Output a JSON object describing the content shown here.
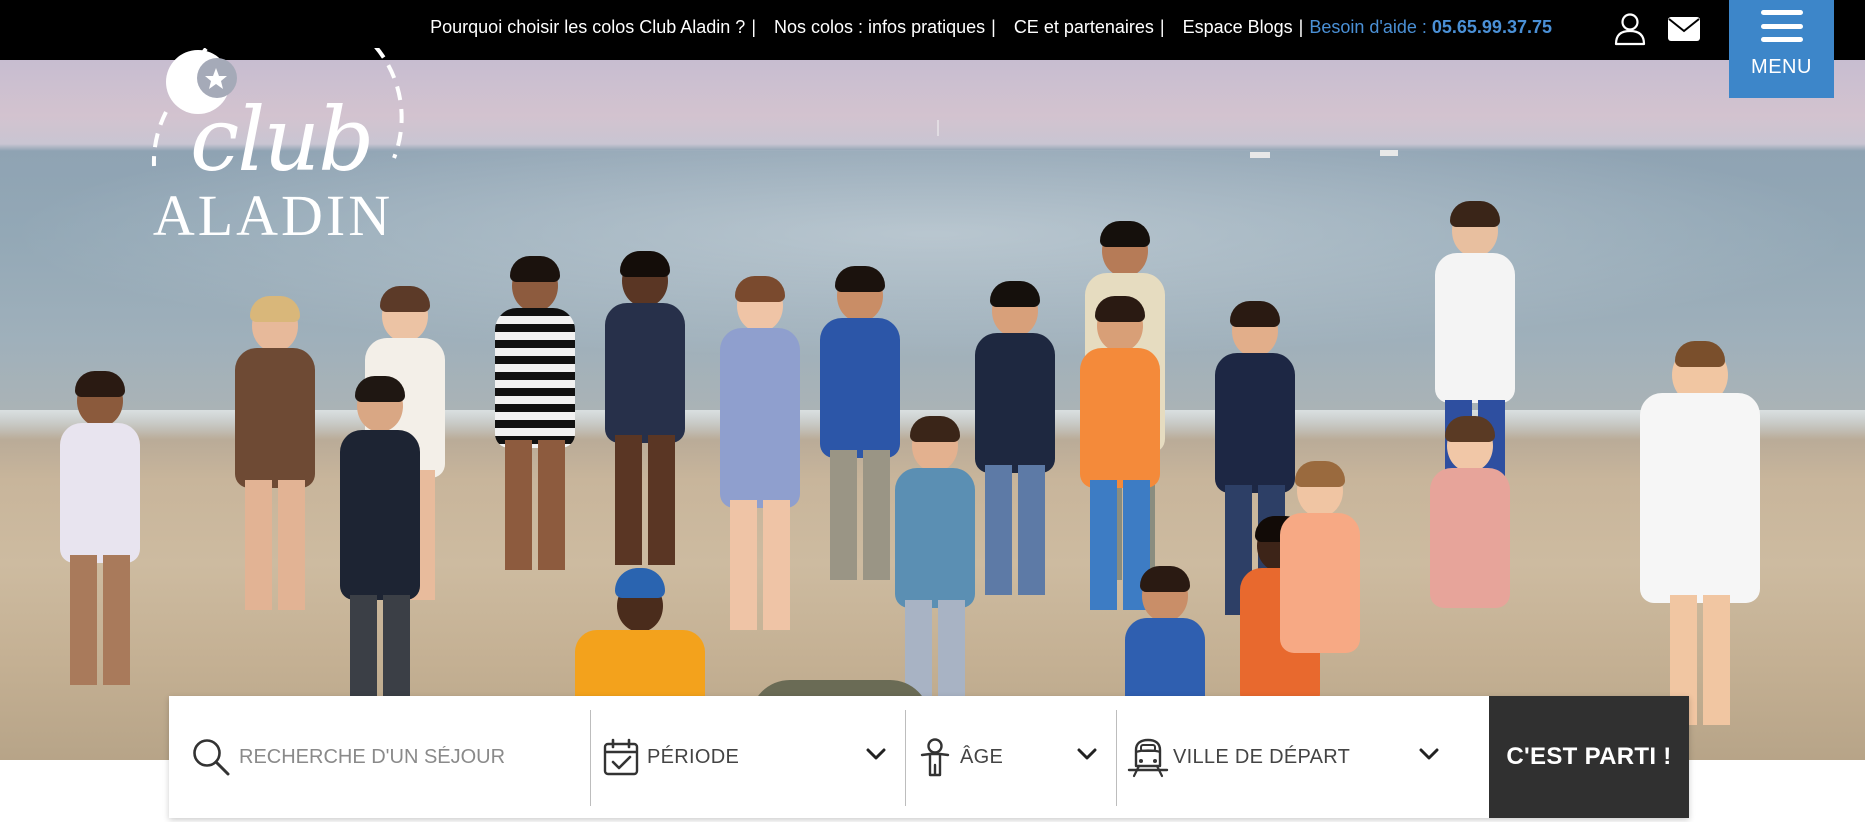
{
  "topnav": {
    "links": [
      "Pourquoi choisir les colos Club Aladin ?",
      "Nos colos : infos pratiques",
      "CE et partenaires",
      "Espace Blogs"
    ],
    "separator": "|",
    "help_label": "Besoin d'aide : ",
    "help_phone": "05.65.99.37.75",
    "account_icon": "user-icon",
    "contact_icon": "envelope-icon",
    "menu_label": "MENU",
    "menu_icon": "hamburger-icon"
  },
  "logo": {
    "script": "club",
    "name": "ALADIN"
  },
  "search": {
    "keyword_placeholder": "RECHERCHE D'UN SÉJOUR",
    "keyword_value": "",
    "period_label": "PÉRIODE",
    "age_label": "ÂGE",
    "departure_label": "VILLE DE DÉPART",
    "submit_label": "C'EST PARTI !",
    "icons": [
      "search-icon",
      "calendar-icon",
      "child-icon",
      "train-icon",
      "chevron-down-icon"
    ]
  },
  "colors": {
    "topbar": "#000000",
    "accent_blue": "#3d86c9",
    "help_text": "#4a90d6",
    "submit_bg": "#303030"
  }
}
